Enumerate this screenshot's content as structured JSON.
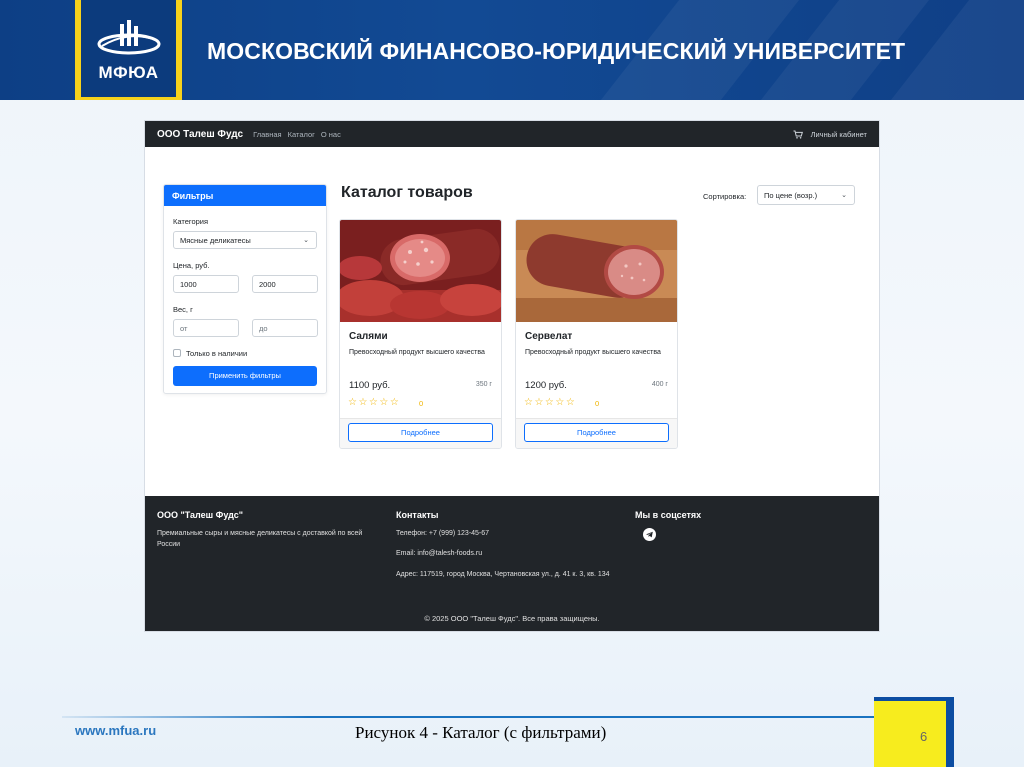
{
  "slide": {
    "logo_text": "МФЮА",
    "university": "МОСКОВСКИЙ ФИНАНСОВО-ЮРИДИЧЕСКИЙ УНИВЕРСИТЕТ",
    "site": "www.mfua.ru",
    "caption": "Рисунок 4 - Каталог (с фильтрами)",
    "page_number": "6",
    "colors": {
      "header_blue": "#0d3f85",
      "accent_yellow": "#f7d21b"
    }
  },
  "navbar": {
    "brand": "ООО Талеш Фудс",
    "links": [
      "Главная",
      "Каталог",
      "О нас"
    ],
    "account": "Личный кабинет",
    "cart_icon": "cart-icon"
  },
  "filters": {
    "title": "Фильтры",
    "category_label": "Категория",
    "category_value": "Мясные деликатесы",
    "price_label": "Цена, руб.",
    "price_from": "1000",
    "price_to": "2000",
    "weight_label": "Вес, г",
    "weight_from_placeholder": "от",
    "weight_to_placeholder": "до",
    "in_stock_label": "Только в наличии",
    "in_stock_checked": false,
    "apply_label": "Применить фильтры"
  },
  "catalog": {
    "title": "Каталог товаров",
    "sort_label": "Сортировка:",
    "sort_value": "По цене (возр.)",
    "products": [
      {
        "name": "Салями",
        "description": "Превосходный продукт высшего качества",
        "price": "1100 руб.",
        "weight": "350 г",
        "stars": "☆☆☆☆☆",
        "rating": "0",
        "button": "Подробнее"
      },
      {
        "name": "Сервелат",
        "description": "Превосходный продукт высшего качества",
        "price": "1200 руб.",
        "weight": "400 г",
        "stars": "☆☆☆☆☆",
        "rating": "0",
        "button": "Подробнее"
      }
    ]
  },
  "footer": {
    "company_title": "ООО \"Талеш Фудс\"",
    "company_text": "Премиальные сыры и мясные деликатесы с доставкой по всей России",
    "contacts_title": "Контакты",
    "phone": "Телефон: +7 (999) 123-45-67",
    "email": "Email: info@talesh-foods.ru",
    "address": "Адрес: 117519, город Москва, Чертановская ул., д. 41 к. 3, кв. 134",
    "social_title": "Мы в соцсетях",
    "social_icon": "telegram-icon",
    "copyright": "© 2025 ООО \"Талеш Фудс\". Все права защищены."
  }
}
